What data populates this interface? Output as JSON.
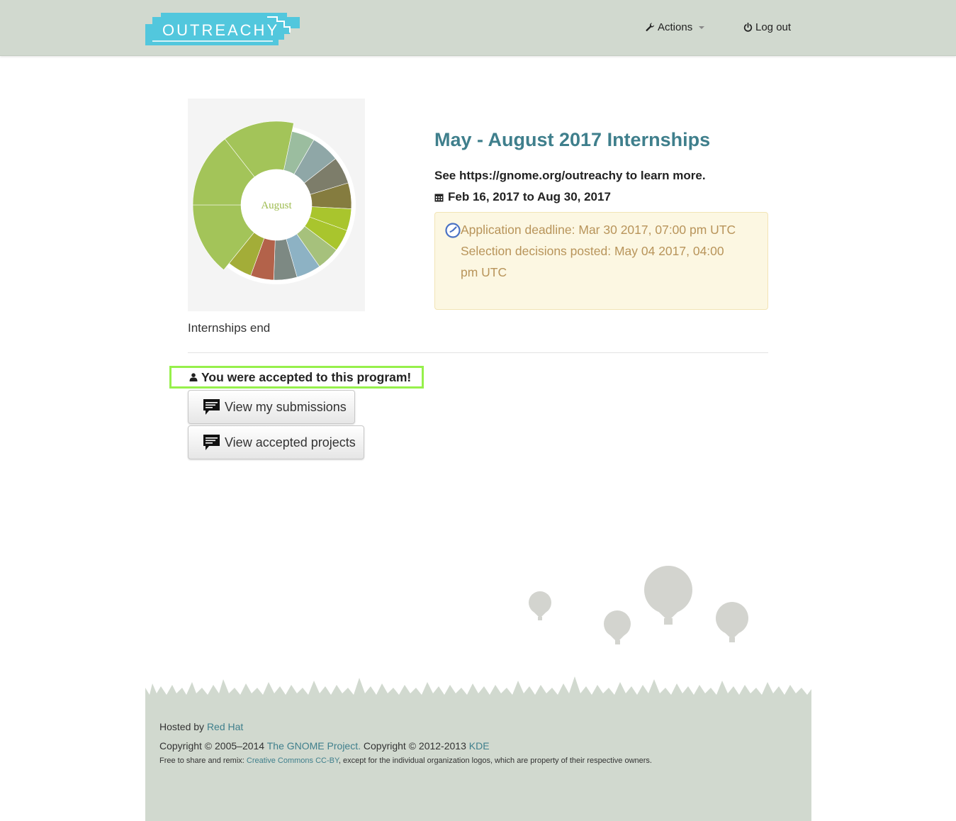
{
  "nav": {
    "logo_text": "OUTREACHY",
    "actions_label": "Actions",
    "logout_label": "Log out"
  },
  "wheel": {
    "center_label": "August",
    "caption": "Internships end"
  },
  "round": {
    "title": "May - August 2017 Internships",
    "learn_more": "See https://gnome.org/outreachy to learn more.",
    "dates": "Feb 16, 2017 to Aug 30, 2017",
    "deadline_line": "Application deadline: Mar 30 2017, 07:00 pm UTC",
    "decisions_line": "Selection decisions posted: May 04 2017, 04:00 pm UTC"
  },
  "status": {
    "accepted_text": "You were accepted to this program!"
  },
  "buttons": {
    "submissions_label": "View my submissions",
    "projects_label": "View accepted projects"
  },
  "footer": {
    "hosted_prefix": "Hosted by",
    "hosted_link": "Red Hat",
    "copyright_prefix": "Copyright © 2005–2014",
    "gnome_link": "The GNOME Project.",
    "copyright_mid": "Copyright © 2012-2013",
    "kde_link": "KDE",
    "license_prefix": "Free to share and remix:",
    "license_link": "Creative Commons CC-BY",
    "license_suffix": ", except for the individual organization logos, which are property of their respective owners."
  },
  "colors": {
    "navbar": "#d1d9cf",
    "accent": "#3f7f8c",
    "alert_bg": "#fcf7e2",
    "alert_text": "#b8945a",
    "highlight": "#96f04b"
  },
  "icons": [
    "wrench-icon",
    "power-icon",
    "calendar-icon",
    "clock-icon",
    "person-icon",
    "chat-icon"
  ]
}
